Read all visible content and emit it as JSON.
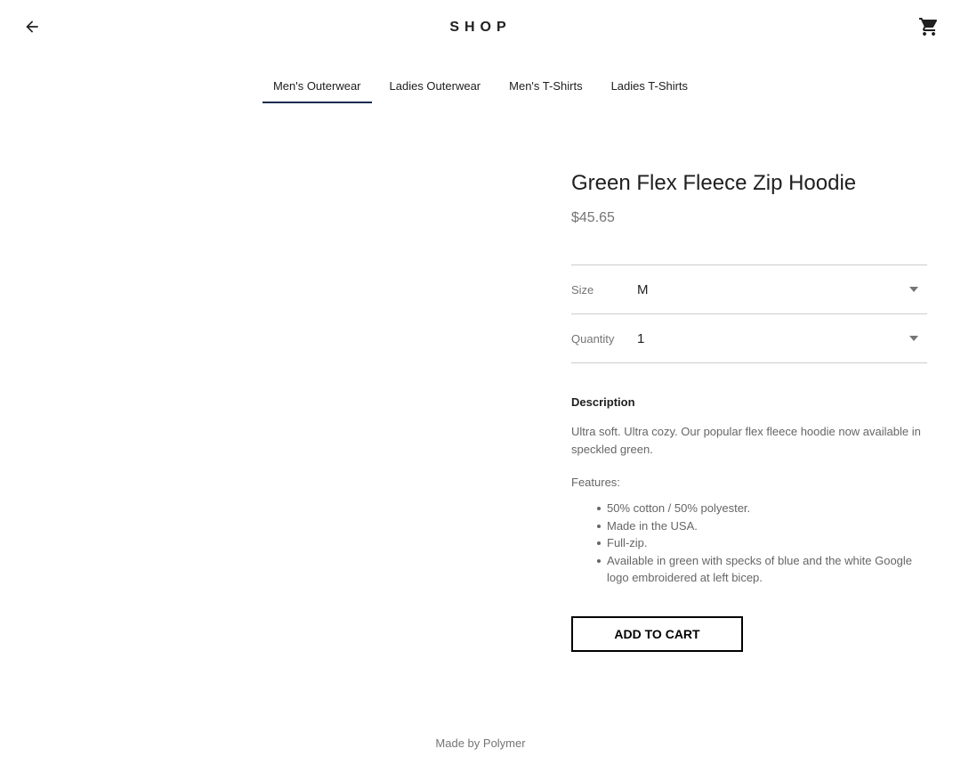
{
  "header": {
    "logo": "SHOP",
    "back_icon": "arrow-back-icon",
    "cart_icon": "shopping-cart-icon"
  },
  "tabs": [
    {
      "label": "Men's Outerwear",
      "active": true
    },
    {
      "label": "Ladies Outerwear",
      "active": false
    },
    {
      "label": "Men's T-Shirts",
      "active": false
    },
    {
      "label": "Ladies T-Shirts",
      "active": false
    }
  ],
  "product": {
    "title": "Green Flex Fleece Zip Hoodie",
    "price": "$45.65",
    "size": {
      "label": "Size",
      "value": "M"
    },
    "quantity": {
      "label": "Quantity",
      "value": "1"
    },
    "description_heading": "Description",
    "description": "Ultra soft. Ultra cozy. Our popular flex fleece hoodie now available in speckled green.",
    "features_label": "Features:",
    "features": [
      "50% cotton / 50% polyester.",
      "Made in the USA.",
      "Full-zip.",
      "Available in green with specks of blue and the white Google logo embroidered at left bicep."
    ],
    "add_to_cart": "ADD TO CART"
  },
  "footer": {
    "text": "Made by Polymer"
  },
  "colors": {
    "tab_underline": "#172c50",
    "divider": "#cccccc",
    "muted_text": "#757575"
  }
}
